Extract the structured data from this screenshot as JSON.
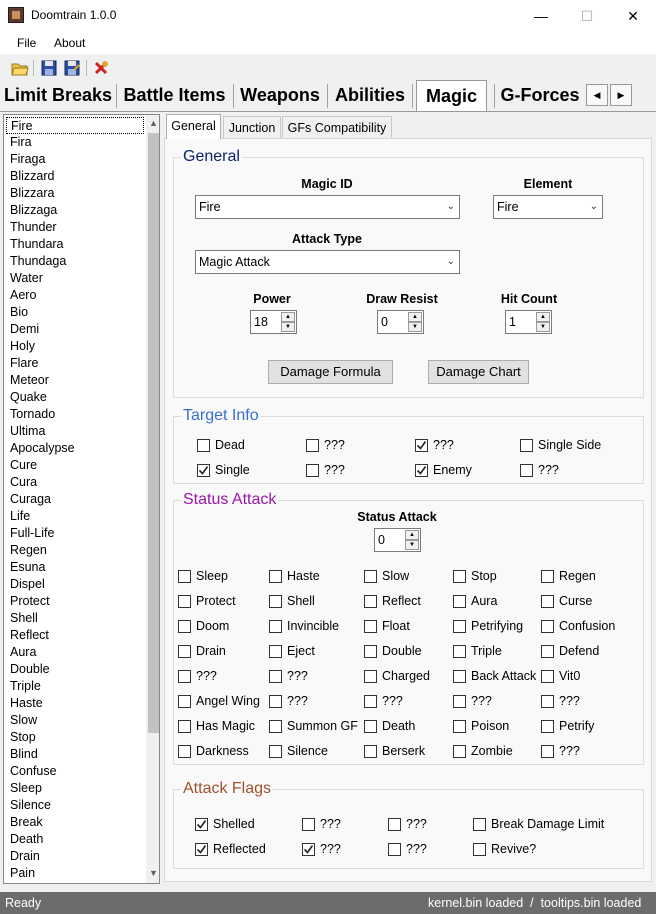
{
  "window": {
    "title": "Doomtrain 1.0.0",
    "min_glyph": "—",
    "max_glyph": "☐",
    "close_glyph": "✕"
  },
  "menu": {
    "file": "File",
    "about": "About"
  },
  "toolbar": {
    "icons": [
      "open-folder-icon",
      "save-icon",
      "save-as-icon",
      "close-file-icon"
    ]
  },
  "main_tabs": [
    "Limit Breaks",
    "Battle Items",
    "Weapons",
    "Abilities",
    "Magic",
    "G-Forces"
  ],
  "main_tabs_active": "Magic",
  "scroll": {
    "left": "◀",
    "right": "▶",
    "up": "▲",
    "down": "▼"
  },
  "magic_list": [
    "Fire",
    "Fira",
    "Firaga",
    "Blizzard",
    "Blizzara",
    "Blizzaga",
    "Thunder",
    "Thundara",
    "Thundaga",
    "Water",
    "Aero",
    "Bio",
    "Demi",
    "Holy",
    "Flare",
    "Meteor",
    "Quake",
    "Tornado",
    "Ultima",
    "Apocalypse",
    "Cure",
    "Cura",
    "Curaga",
    "Life",
    "Full-Life",
    "Regen",
    "Esuna",
    "Dispel",
    "Protect",
    "Shell",
    "Reflect",
    "Aura",
    "Double",
    "Triple",
    "Haste",
    "Slow",
    "Stop",
    "Blind",
    "Confuse",
    "Sleep",
    "Silence",
    "Break",
    "Death",
    "Drain",
    "Pain"
  ],
  "selected_magic": "Fire",
  "sub_tabs": [
    "General",
    "Junction",
    "GFs Compatibility"
  ],
  "general": {
    "title": "General",
    "magic_id_label": "Magic ID",
    "magic_id_value": "Fire",
    "element_label": "Element",
    "element_value": "Fire",
    "attack_type_label": "Attack Type",
    "attack_type_value": "Magic Attack",
    "power_label": "Power",
    "power_value": "18",
    "draw_resist_label": "Draw Resist",
    "draw_resist_value": "0",
    "hit_count_label": "Hit Count",
    "hit_count_value": "1",
    "damage_formula": "Damage Formula",
    "damage_chart": "Damage Chart"
  },
  "target_info": {
    "title": "Target Info",
    "checkboxes": [
      {
        "label": "Dead",
        "checked": false
      },
      {
        "label": "???",
        "checked": false
      },
      {
        "label": "???",
        "checked": true
      },
      {
        "label": "Single Side",
        "checked": false
      },
      {
        "label": "Single",
        "checked": true
      },
      {
        "label": "???",
        "checked": false
      },
      {
        "label": "Enemy",
        "checked": true
      },
      {
        "label": "???",
        "checked": false
      }
    ]
  },
  "status_attack": {
    "title": "Status Attack",
    "field_label": "Status Attack",
    "field_value": "0",
    "checkboxes": [
      [
        "Sleep",
        "Haste",
        "Slow",
        "Stop",
        "Regen"
      ],
      [
        "Protect",
        "Shell",
        "Reflect",
        "Aura",
        "Curse"
      ],
      [
        "Doom",
        "Invincible",
        "Float",
        "Petrifying",
        "Confusion"
      ],
      [
        "Drain",
        "Eject",
        "Double",
        "Triple",
        "Defend"
      ],
      [
        "???",
        "???",
        "Charged",
        "Back Attack",
        "Vit0"
      ],
      [
        "Angel Wing",
        "???",
        "???",
        "???",
        "???"
      ],
      [
        "Has Magic",
        "Summon GF",
        "Death",
        "Poison",
        "Petrify"
      ],
      [
        "Darkness",
        "Silence",
        "Berserk",
        "Zombie",
        "???"
      ]
    ]
  },
  "attack_flags": {
    "title": "Attack Flags",
    "checkboxes": [
      {
        "label": "Shelled",
        "checked": true
      },
      {
        "label": "???",
        "checked": false
      },
      {
        "label": "???",
        "checked": false
      },
      {
        "label": "Break Damage Limit",
        "checked": false
      },
      {
        "label": "Reflected",
        "checked": true
      },
      {
        "label": "???",
        "checked": true
      },
      {
        "label": "???",
        "checked": false
      },
      {
        "label": "Revive?",
        "checked": false
      }
    ]
  },
  "status_bar": {
    "left": "Ready",
    "right": "kernel.bin loaded  /  tooltips.bin loaded"
  },
  "colors": {
    "general_title": "#0a246a",
    "target_title": "#3a6fd0",
    "status_title": "#9a18a8",
    "flags_title": "#a0522d"
  }
}
